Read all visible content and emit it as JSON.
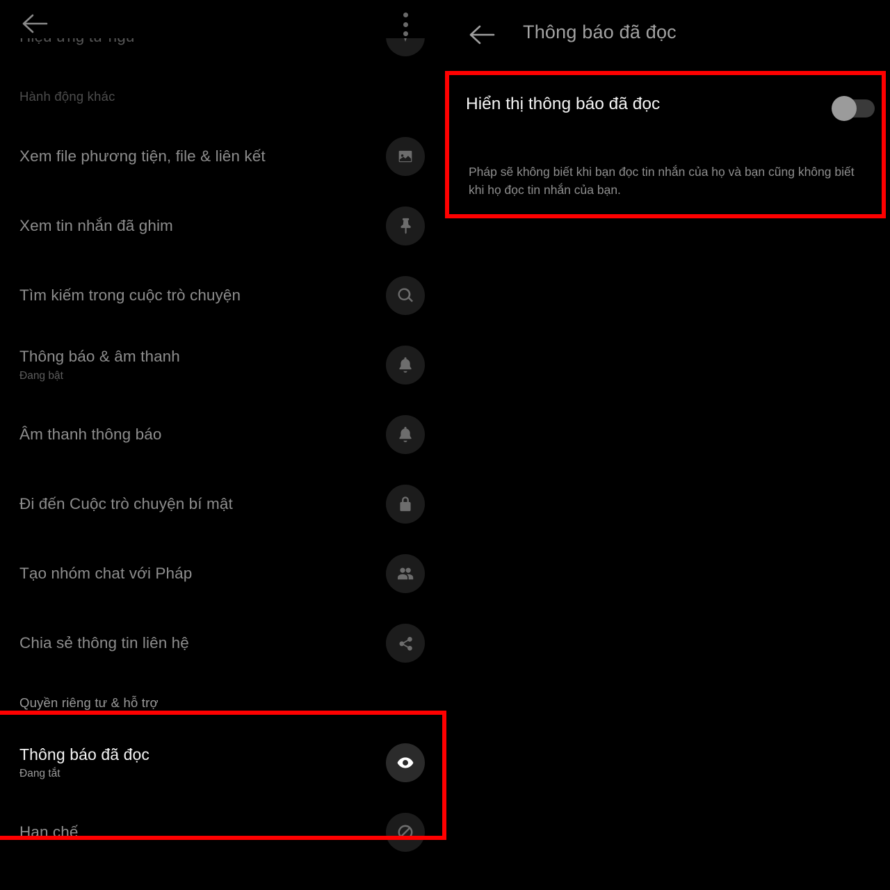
{
  "left_panel": {
    "topbar": {
      "back_icon": "back-arrow-icon",
      "overflow_icon": "kebab-menu-icon"
    },
    "partial_item": {
      "title": "Hiệu ứng từ ngữ",
      "icon": "sparkle-icon"
    },
    "section_other_actions": "Hành động khác",
    "items": [
      {
        "title": "Xem file phương tiện, file & liên kết",
        "subtitle": "",
        "icon": "image-icon"
      },
      {
        "title": "Xem tin nhắn đã ghim",
        "subtitle": "",
        "icon": "pin-icon"
      },
      {
        "title": "Tìm kiếm trong cuộc trò chuyện",
        "subtitle": "",
        "icon": "search-icon"
      },
      {
        "title": "Thông báo & âm thanh",
        "subtitle": "Đang bật",
        "icon": "bell-icon"
      },
      {
        "title": "Âm thanh thông báo",
        "subtitle": "",
        "icon": "bell-icon"
      },
      {
        "title": "Đi đến Cuộc trò chuyện bí mật",
        "subtitle": "",
        "icon": "lock-icon"
      },
      {
        "title": "Tạo nhóm chat với Pháp",
        "subtitle": "",
        "icon": "people-icon"
      },
      {
        "title": "Chia sẻ thông tin liên hệ",
        "subtitle": "",
        "icon": "share-icon"
      }
    ],
    "section_privacy": "Quyền riêng tư & hỗ trợ",
    "active_item": {
      "title": "Thông báo đã đọc",
      "subtitle": "Đang tắt",
      "icon": "eye-icon"
    },
    "last_item": {
      "title": "Hạn chế",
      "subtitle": "",
      "icon": "restrict-icon"
    }
  },
  "right_panel": {
    "back_icon": "back-arrow-icon",
    "title": "Thông báo đã đọc",
    "toggle": {
      "label": "Hiển thị thông báo đã đọc",
      "state": "off"
    },
    "description": "Pháp sẽ không biết khi bạn đọc tin nhắn của họ và bạn cũng không biết khi họ đọc tin nhắn của bạn."
  },
  "annotations": {
    "highlight_color": "#ff0000",
    "boxes": [
      "right-toggle-section",
      "left-read-receipts-section"
    ]
  }
}
